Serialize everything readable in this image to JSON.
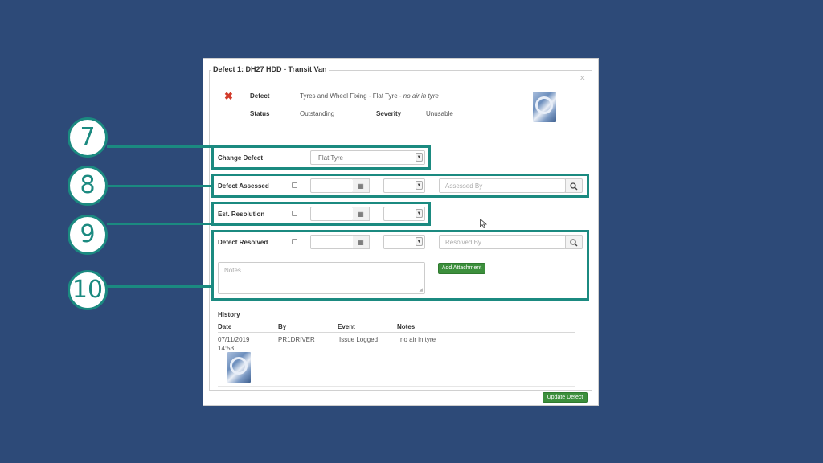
{
  "colors": {
    "background": "#2d4a78",
    "accent_teal": "#1b8a80",
    "button_green": "#3c8f3c",
    "error_red": "#d23a2a"
  },
  "modal": {
    "title": "Defect 1: DH27 HDD - Transit Van",
    "close_icon": "close-icon",
    "summary": {
      "defect_label": "Defect",
      "defect_value": "Tyres and Wheel Fixing - Flat Tyre - ",
      "defect_note": "no air in tyre",
      "status_label": "Status",
      "status_value": "Outstanding",
      "severity_label": "Severity",
      "severity_value": "Unusable"
    },
    "change_defect": {
      "label": "Change Defect",
      "selected": "Flat Tyre"
    },
    "defect_assessed": {
      "label": "Defect Assessed",
      "placeholder": "Assessed By"
    },
    "est_resolution": {
      "label": "Est. Resolution"
    },
    "defect_resolved": {
      "label": "Defect Resolved",
      "placeholder": "Resolved By"
    },
    "notes": {
      "placeholder": "Notes"
    },
    "add_attachment": "Add Attachment",
    "history": {
      "title": "History",
      "columns": [
        "Date",
        "By",
        "Event",
        "Notes"
      ],
      "rows": [
        {
          "date": "07/11/2019",
          "time": "14:53",
          "by": "PR1DRIVER",
          "event": "Issue Logged",
          "notes": "no air in tyre"
        }
      ]
    },
    "update_button": "Update Defect"
  },
  "callouts": [
    "7",
    "8",
    "9",
    "10"
  ]
}
